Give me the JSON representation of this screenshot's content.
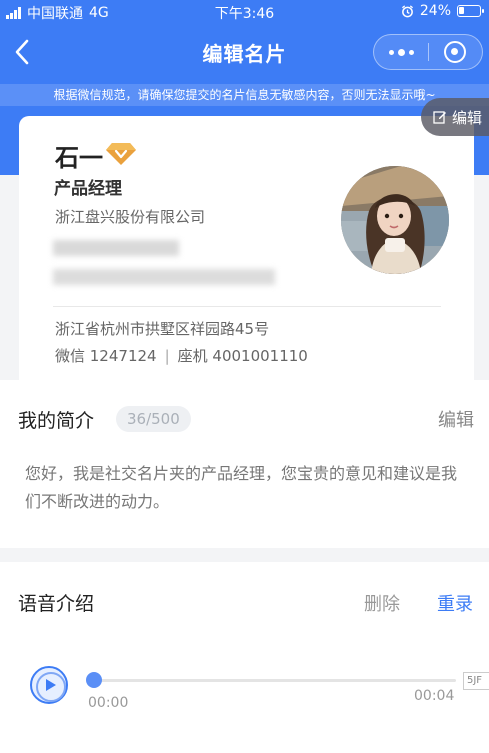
{
  "status_bar": {
    "carrier": "中国联通",
    "network": "4G",
    "time": "下午3:46",
    "battery": "24%"
  },
  "nav": {
    "title": "编辑名片"
  },
  "notice": "根据微信规范，请确保您提交的名片信息无敏感内容，否则无法显示哦~",
  "card": {
    "edit_label": "编辑",
    "name": "石一",
    "position": "产品经理",
    "company": "浙江盘兴股份有限公司",
    "address": "浙江省杭州市拱墅区祥园路45号",
    "wechat": "微信 1247124",
    "separator": "|",
    "landline": "座机 4001001110",
    "vip_color": "#e8a640"
  },
  "intro": {
    "title": "我的简介",
    "count": "36/500",
    "edit_label": "编辑",
    "text": "您好，我是社交名片夹的产品经理，您宝贵的意见和建议是我们不断改进的动力。"
  },
  "voice": {
    "title": "语音介绍",
    "delete_label": "删除",
    "rerecord_label": "重录",
    "current_time": "00:00",
    "total_time": "00:04",
    "progress": 0
  },
  "side_tag": "5JF",
  "colors": {
    "accent": "#3d7cf5",
    "notice_bg": "#5b90f7"
  }
}
